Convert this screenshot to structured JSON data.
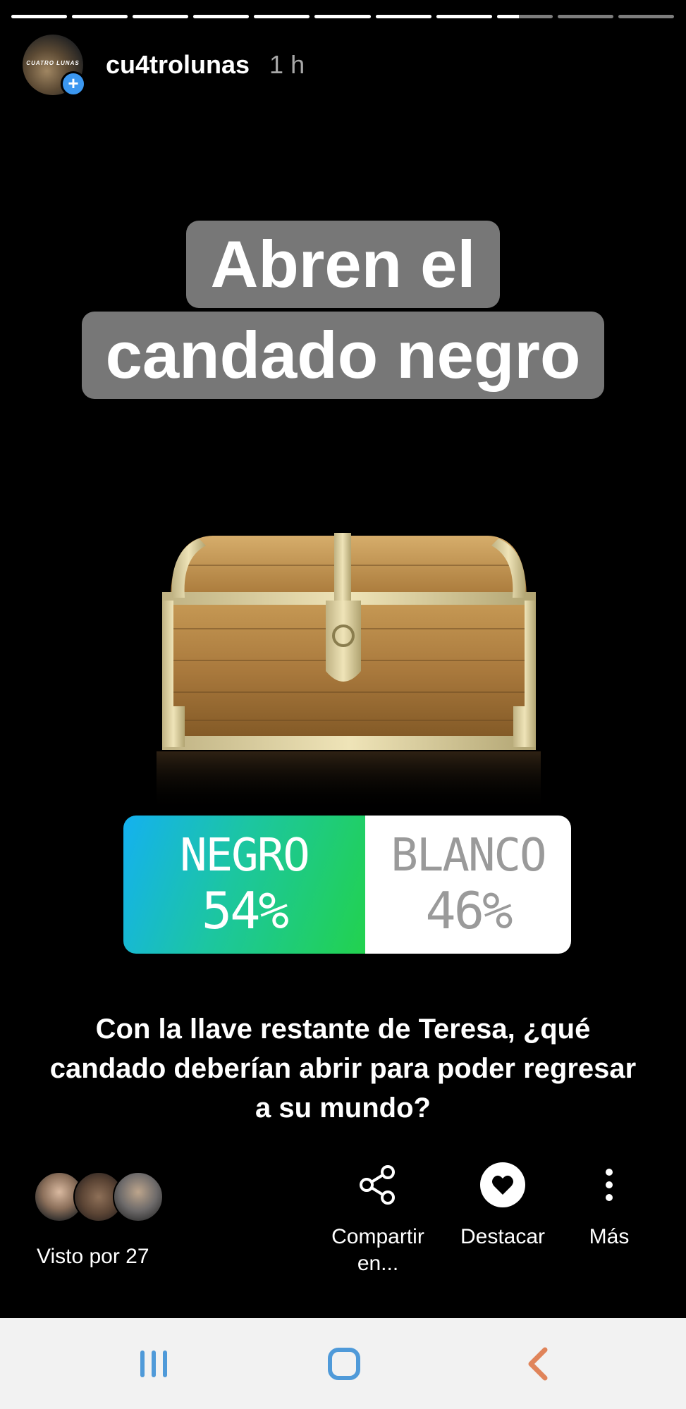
{
  "story": {
    "progress_segments": 11,
    "progress_completed": 8,
    "progress_current_fraction": 0.4,
    "username": "cu4trolunas",
    "time_ago": "1 h",
    "avatar_text": "CUATRO LUNAS",
    "title_line_1": "Abren el",
    "title_line_2": "candado negro",
    "question": "Con la llave restante de Teresa, ¿qué candado deberían abrir para poder regresar a su mundo?"
  },
  "poll": {
    "options": [
      {
        "label": "NEGRO",
        "percent": "54%",
        "value": 54
      },
      {
        "label": "BLANCO",
        "percent": "46%",
        "value": 46
      }
    ]
  },
  "footer": {
    "viewed_by": "Visto por 27",
    "share_line_1": "Compartir",
    "share_line_2": "en...",
    "highlight_label": "Destacar",
    "more_label": "Más"
  },
  "navbar": {
    "recents_icon": "recents-icon",
    "home_icon": "home-icon",
    "back_icon": "back-icon"
  },
  "colors": {
    "poll_gradient_start": "#14b1f0",
    "poll_gradient_end": "#22d24e",
    "title_box": "#777777",
    "plus_badge": "#3b97f0",
    "back_icon": "#e0845a",
    "nav_icon": "#4f9ad9"
  }
}
